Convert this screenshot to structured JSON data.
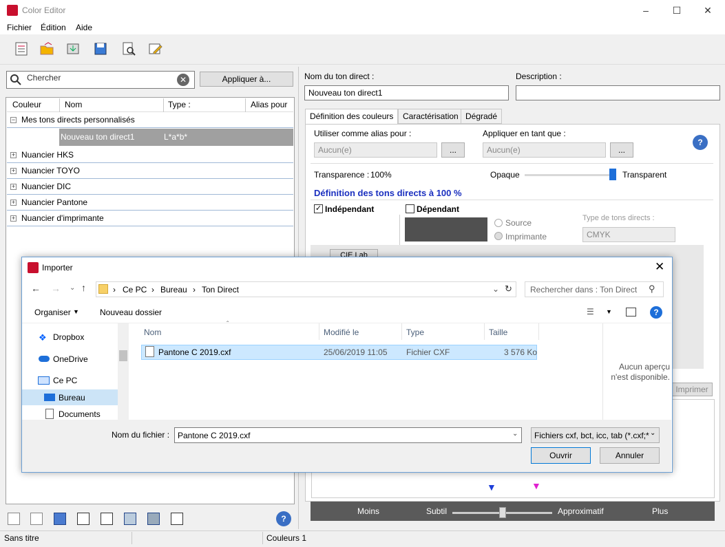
{
  "window": {
    "title": "Color Editor"
  },
  "menu": [
    "Fichier",
    "Édition",
    "Aide"
  ],
  "toolbar": {
    "icons": [
      "list-icon",
      "folder-open-icon",
      "import-icon",
      "save-icon",
      "search-doc-icon",
      "edit-icon"
    ]
  },
  "left": {
    "search_placeholder": "Chercher",
    "apply_button": "Appliquer à...",
    "columns": [
      "Couleur",
      "Nom",
      "Type :",
      "Alias pour"
    ],
    "group_custom": "Mes tons directs personnalisés",
    "selected_item": {
      "name": "Nouveau ton direct1",
      "type": "L*a*b*"
    },
    "groups": [
      "Nuancier HKS",
      "Nuancier TOYO",
      "Nuancier DIC",
      "Nuancier Pantone",
      "Nuancier d'imprimante"
    ]
  },
  "right": {
    "name_label": "Nom du ton direct :",
    "name_value": "Nouveau ton direct1",
    "desc_label": "Description :",
    "desc_value": "",
    "tabs": [
      "Définition des couleurs",
      "Caractérisation",
      "Dégradé"
    ],
    "alias_label": "Utiliser comme alias pour :",
    "alias_value": "Aucun(e)",
    "apply_as_label": "Appliquer en tant que :",
    "apply_as_value": "Aucun(e)",
    "browse": "...",
    "transparency_label": "Transparence :",
    "transparency_value": "100%",
    "opaque": "Opaque",
    "transparent": "Transparent",
    "section_title": "Définition des tons directs à 100 %",
    "independent": "Indépendant",
    "dependent": "Dépendant",
    "source": "Source",
    "printer": "Imprimante",
    "spot_type_label": "Type de tons directs :",
    "spot_type_value": "CMYK",
    "color_space": "CIE Lab",
    "print_btn": "Imprimer",
    "slider_labels": [
      "Moins",
      "Subtil",
      "Approximatif",
      "Plus"
    ]
  },
  "status": {
    "left": "Sans titre",
    "right": "Couleurs 1"
  },
  "dialog": {
    "title": "Importer",
    "path": [
      "Ce PC",
      "Bureau",
      "Ton Direct"
    ],
    "search_placeholder": "Rechercher dans : Ton Direct",
    "organize": "Organiser",
    "new_folder": "Nouveau dossier",
    "nav": [
      "Dropbox",
      "OneDrive",
      "Ce PC",
      "Bureau",
      "Documents"
    ],
    "columns": [
      "Nom",
      "Modifié le",
      "Type",
      "Taille"
    ],
    "file": {
      "name": "Pantone C 2019.cxf",
      "modified": "25/06/2019 11:05",
      "type": "Fichier CXF",
      "size": "3 576 Ko"
    },
    "preview": "Aucun aperçu n'est disponible.",
    "filename_label": "Nom du fichier :",
    "filename_value": "Pantone C 2019.cxf",
    "filter": "Fichiers cxf, bct, icc, tab (*.cxf;*",
    "open": "Ouvrir",
    "cancel": "Annuler"
  }
}
